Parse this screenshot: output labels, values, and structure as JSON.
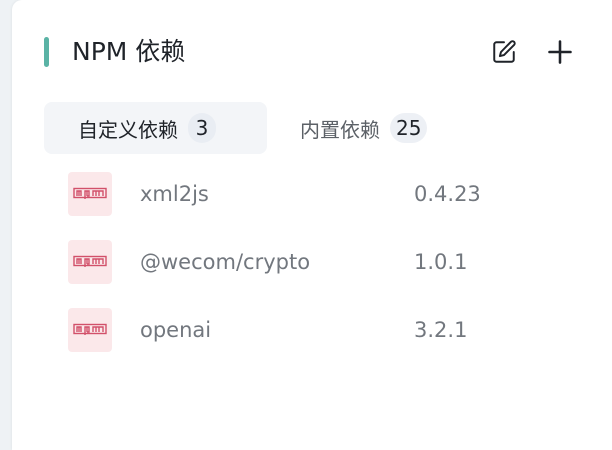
{
  "header": {
    "title": "NPM 依赖",
    "accent_color": "#5ab3a5",
    "edit_icon": "edit-icon",
    "add_icon": "plus-icon"
  },
  "tabs": [
    {
      "label": "自定义依赖",
      "count": "3",
      "active": true
    },
    {
      "label": "内置依赖",
      "count": "25",
      "active": false
    }
  ],
  "dependencies": [
    {
      "icon": "npm-icon",
      "name": "xml2js",
      "version": "0.4.23"
    },
    {
      "icon": "npm-icon",
      "name": "@wecom/crypto",
      "version": "1.0.1"
    },
    {
      "icon": "npm-icon",
      "name": "openai",
      "version": "3.2.1"
    }
  ],
  "colors": {
    "npm_brand": "#cb3837",
    "npm_icon_bg": "#fbe8ea"
  }
}
